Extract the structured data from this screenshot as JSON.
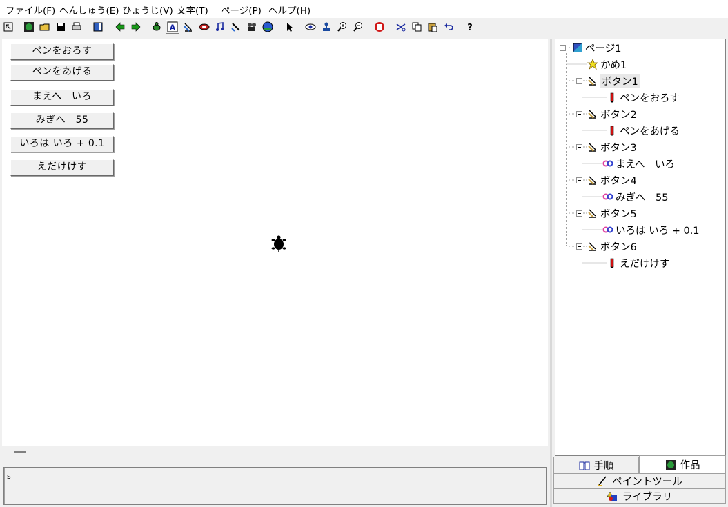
{
  "menu": [
    "ファイル(F)",
    "へんしゅう(E)",
    "ひょうじ(V)",
    "文字(T)",
    "ページ(P)",
    "ヘルプ(H)"
  ],
  "toolbar": {
    "icons": [
      "pointer-select-icon",
      "globe-icon",
      "open-folder-icon",
      "save-disk-icon",
      "print-icon",
      "page-view-icon",
      "back-arrow-icon",
      "forward-arrow-icon",
      "turtle-tool-icon",
      "text-tool-icon",
      "button-tool-icon",
      "switch-tool-icon",
      "music-tool-icon",
      "drawing-tool-icon",
      "movie-tool-icon",
      "globe-tool-icon",
      "arrow-cursor-icon",
      "eye-icon",
      "stamp-icon",
      "zoom-in-icon",
      "zoom-out-icon",
      "stop-hand-icon",
      "cut-icon",
      "copy-icon",
      "paste-icon",
      "undo-icon",
      "help-icon"
    ]
  },
  "canvas": {
    "buttons": [
      "ペンをおろす",
      "ペンをあげる",
      "まえへ　いろ",
      "みぎへ　55",
      "いろは いろ + 0.1",
      "えだけけす"
    ]
  },
  "command": {
    "text": "s"
  },
  "tree": {
    "root": "ページ1",
    "turtle": "かめ1",
    "buttons": [
      {
        "label": "ボタン1",
        "action": "ペンをおろす",
        "action_icon": "pen-icon"
      },
      {
        "label": "ボタン2",
        "action": "ペンをあげる",
        "action_icon": "pen-icon"
      },
      {
        "label": "ボタン3",
        "action": "まえへ　いろ",
        "action_icon": "loop-icon"
      },
      {
        "label": "ボタン4",
        "action": "みぎへ　55",
        "action_icon": "loop-icon"
      },
      {
        "label": "ボタン5",
        "action": "いろは いろ + 0.1",
        "action_icon": "loop-icon"
      },
      {
        "label": "ボタン6",
        "action": "えだけけす",
        "action_icon": "pen-icon"
      }
    ]
  },
  "tabs": {
    "procedure": "手順",
    "works": "作品",
    "paint": "ペイントツール",
    "library": "ライブラリ"
  },
  "colors": {
    "pen": "#d01010",
    "loop_pink": "#e040a0",
    "loop_blue": "#3040d0",
    "tree_selected": "#e8e8e8"
  }
}
